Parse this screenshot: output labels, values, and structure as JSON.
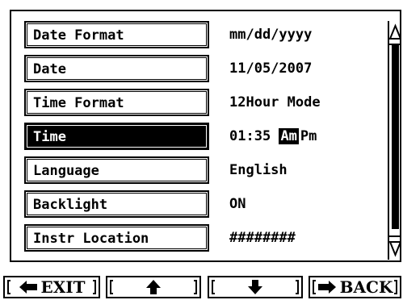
{
  "settings": {
    "rows": [
      {
        "label": "Date Format",
        "value": "mm/dd/yyyy"
      },
      {
        "label": "Date",
        "value": "11/05/2007"
      },
      {
        "label": "Time Format",
        "value": "12Hour Mode"
      },
      {
        "label": "Time",
        "time": "01:35",
        "am": "Am",
        "pm": "Pm",
        "selected_period": "Am"
      },
      {
        "label": "Language",
        "value": "English"
      },
      {
        "label": "Backlight",
        "value": "ON"
      },
      {
        "label": "Instr Location",
        "value": "########"
      }
    ],
    "selected_row": "Time"
  },
  "softkeys": {
    "exit": "EXIT",
    "up": "",
    "down": "",
    "back": "BACK"
  },
  "icons": {
    "exit": "left-arrow-icon",
    "up": "up-arrow-icon",
    "down": "down-arrow-icon",
    "back": "right-arrow-icon",
    "scroll_up": "scroll-up-triangle-icon",
    "scroll_down": "scroll-down-triangle-icon"
  },
  "colors": {
    "foreground": "#000000",
    "background": "#ffffff"
  }
}
